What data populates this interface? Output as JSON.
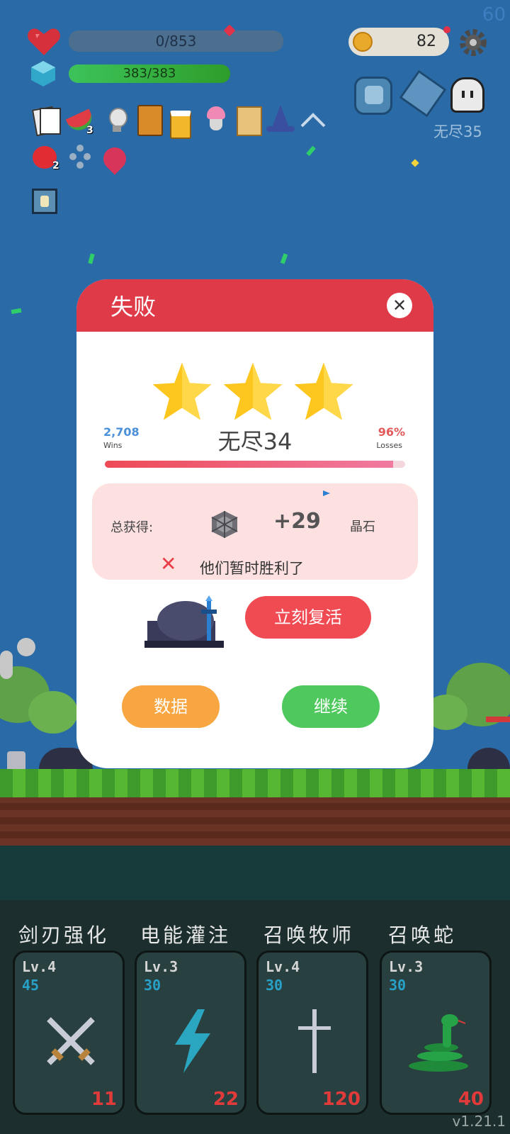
{
  "hud": {
    "fps": "60",
    "hp": "0/853",
    "mana": "383/383",
    "coins": "82",
    "endless_label": "无尽35",
    "items": [
      {
        "icon": "cards-icon",
        "count": ""
      },
      {
        "icon": "watermelon-icon",
        "count": "3"
      },
      {
        "icon": "lightbulb-icon",
        "count": ""
      },
      {
        "icon": "book-icon",
        "count": ""
      },
      {
        "icon": "beer-icon",
        "count": ""
      },
      {
        "icon": "ice-cream-icon",
        "count": ""
      },
      {
        "icon": "scroll-icon",
        "count": ""
      },
      {
        "icon": "wizard-hat-icon",
        "count": ""
      },
      {
        "icon": "apple-icon",
        "count": "2"
      },
      {
        "icon": "clover-icon",
        "count": ""
      },
      {
        "icon": "flame-icon",
        "count": ""
      }
    ]
  },
  "dialog": {
    "title": "失败",
    "stars": 3,
    "level_name": "无尽34",
    "wins_value": "2,708",
    "wins_label": "Wins",
    "losses_value": "96%",
    "losses_label": "Losses",
    "progress_fraction": 0.96,
    "reward_label": "总获得:",
    "reward_amount": "+29",
    "reward_unit": "晶石",
    "defeat_message": "他们暂时胜利了",
    "revive_button": "立刻复活",
    "stats_button": "数据",
    "continue_button": "继续"
  },
  "skills": [
    {
      "name": "剑刃强化",
      "level": "Lv.4",
      "value": "45",
      "cost": "11",
      "icon": "crossed-swords-icon"
    },
    {
      "name": "电能灌注",
      "level": "Lv.3",
      "value": "30",
      "cost": "22",
      "icon": "lightning-icon"
    },
    {
      "name": "召唤牧师",
      "level": "Lv.4",
      "value": "30",
      "cost": "120",
      "icon": "cross-icon"
    },
    {
      "name": "召唤蛇",
      "level": "Lv.3",
      "value": "30",
      "cost": "40",
      "icon": "snake-icon"
    }
  ],
  "version": "v1.21.1",
  "colors": {
    "header_red": "#df3a47",
    "revive_red": "#f04a52",
    "stats_orange": "#f8a642",
    "continue_green": "#4fc95d",
    "wins_blue": "#4a90d9",
    "losses_red": "#e25a5a"
  }
}
